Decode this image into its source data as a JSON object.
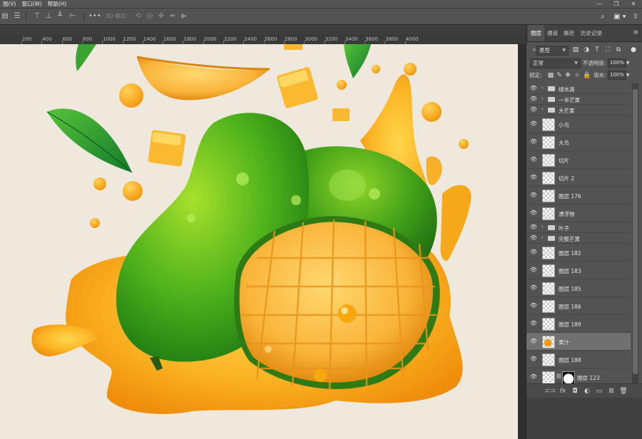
{
  "menubar": {
    "items": [
      "图(V)",
      "窗口(W)",
      "帮助(H)"
    ],
    "window_controls": [
      "—",
      "❐",
      "✕"
    ]
  },
  "options_bar": {
    "mode_3d_label": "3D 模式：",
    "more_icon": "•••"
  },
  "ruler": {
    "ticks": [
      "200",
      "400",
      "600",
      "800",
      "1000",
      "1200",
      "1400",
      "1600",
      "1800",
      "2000",
      "2200",
      "2400",
      "2600",
      "2800",
      "3000",
      "3200",
      "3400",
      "3600",
      "3800",
      "4000"
    ]
  },
  "panel": {
    "tabs": [
      "图层",
      "通道",
      "路径",
      "历史记录"
    ],
    "active_tab": "图层",
    "filter_kind": "类型",
    "blend_mode": "正常",
    "opacity_label": "不透明度:",
    "opacity_value": "100%",
    "lock_label": "锁定:",
    "fill_label": "填充:",
    "fill_value": "100%"
  },
  "layers": [
    {
      "name": "绿水滴",
      "type": "group"
    },
    {
      "name": "一半芒果",
      "type": "group"
    },
    {
      "name": "大芒果",
      "type": "group"
    },
    {
      "name": "小鸟",
      "type": "pixel"
    },
    {
      "name": "大鸟",
      "type": "pixel"
    },
    {
      "name": "切片",
      "type": "pixel"
    },
    {
      "name": "切片 2",
      "type": "pixel"
    },
    {
      "name": "图层 176",
      "type": "pixel"
    },
    {
      "name": "漂浮物",
      "type": "pixel"
    },
    {
      "name": "叶子",
      "type": "group"
    },
    {
      "name": "完整芒果",
      "type": "group"
    },
    {
      "name": "图层 182",
      "type": "pixel"
    },
    {
      "name": "图层 183",
      "type": "pixel"
    },
    {
      "name": "图层 185",
      "type": "pixel"
    },
    {
      "name": "图层 186",
      "type": "pixel"
    },
    {
      "name": "图层 189",
      "type": "pixel"
    },
    {
      "name": "果汁",
      "type": "pixel",
      "selected": true
    },
    {
      "name": "图层 188",
      "type": "pixel"
    },
    {
      "name": "图层 123",
      "type": "masked"
    }
  ],
  "colors": {
    "ui_dark": "#323232",
    "ui_panel": "#535353",
    "canvas_paper": "#efe9dd",
    "mango_green": "#5bbf1f",
    "mango_orange": "#f7a818"
  }
}
